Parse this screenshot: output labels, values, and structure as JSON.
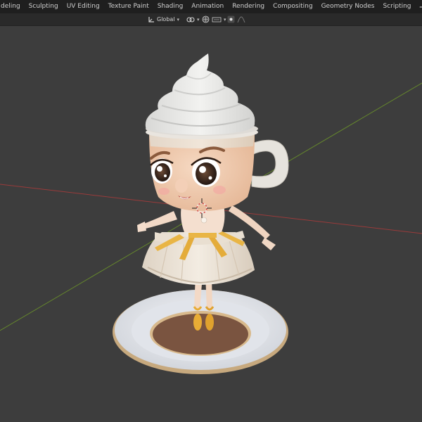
{
  "workspace_tabs": [
    {
      "label": "deling"
    },
    {
      "label": "Sculpting"
    },
    {
      "label": "UV Editing"
    },
    {
      "label": "Texture Paint"
    },
    {
      "label": "Shading"
    },
    {
      "label": "Animation"
    },
    {
      "label": "Rendering"
    },
    {
      "label": "Compositing"
    },
    {
      "label": "Geometry Nodes"
    },
    {
      "label": "Scripting"
    }
  ],
  "add_workspace_label": "+",
  "header": {
    "orientation_label": "Global"
  },
  "colors": {
    "topbar_bg": "#1f1f1f",
    "viewport_bg": "#3d3d3d",
    "x_axis": "#a23a3a",
    "y_axis": "#6b8f2b"
  }
}
